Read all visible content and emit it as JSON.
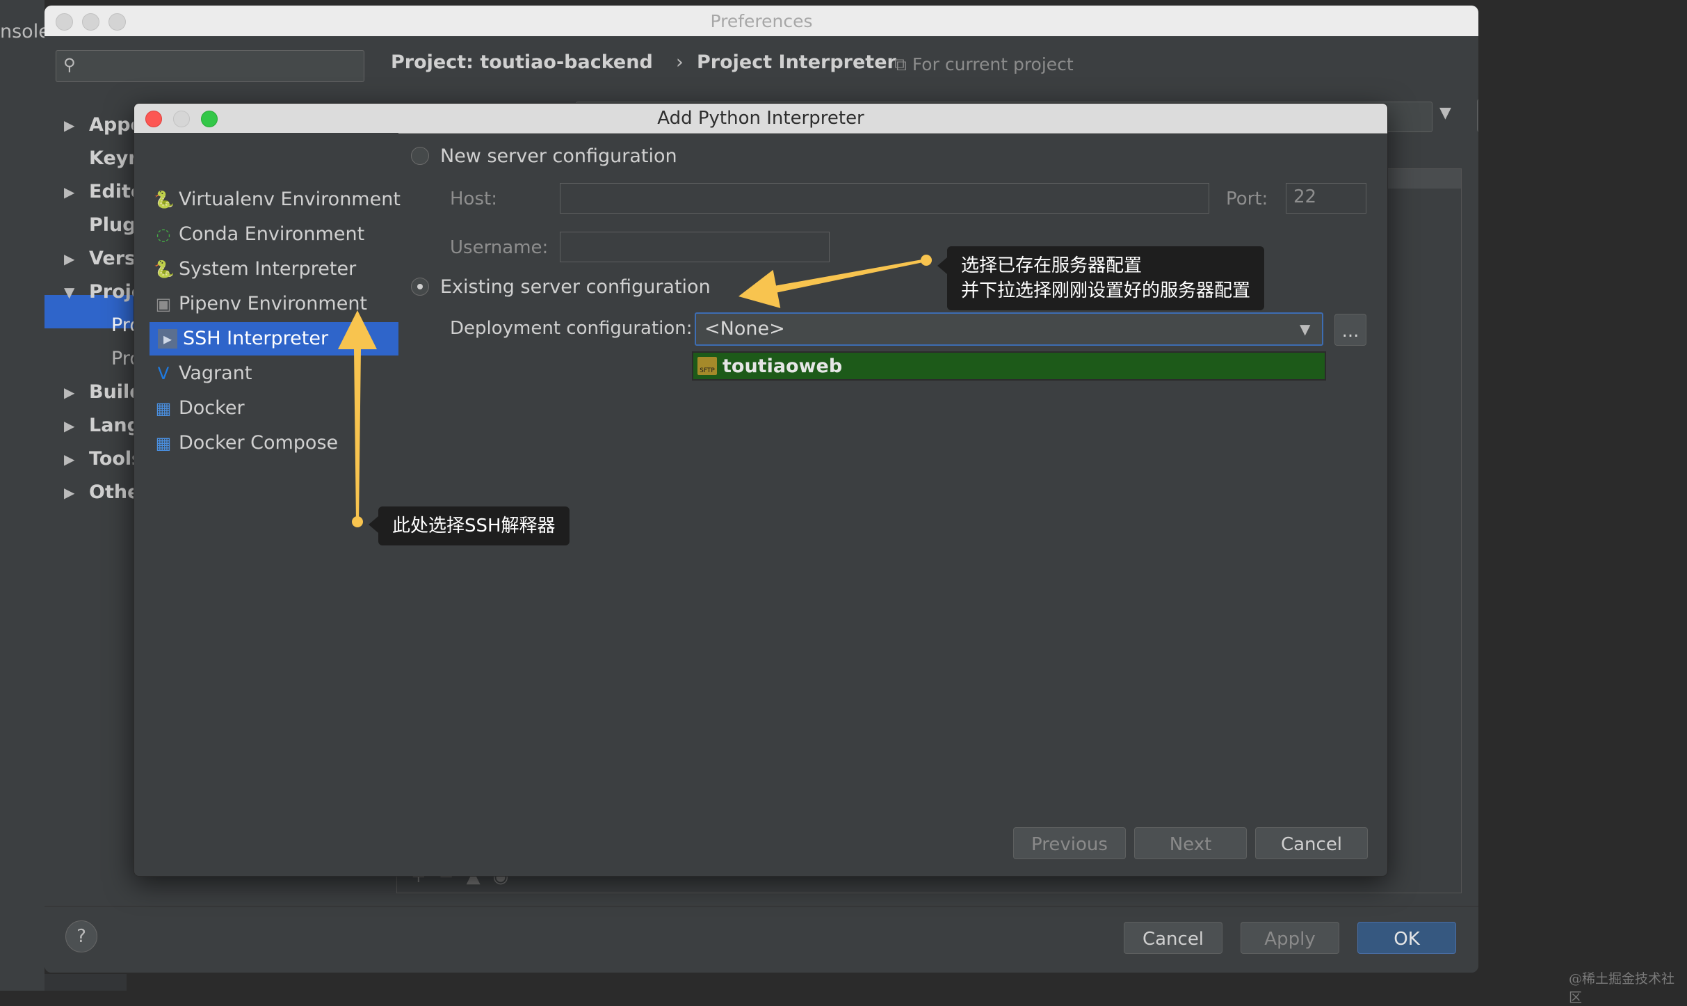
{
  "background": {
    "console_label": "nsole"
  },
  "preferences": {
    "title": "Preferences",
    "search_placeholder": "",
    "tree": [
      {
        "label": "Appe",
        "arrow": "▶",
        "bold": true
      },
      {
        "label": "Keyn",
        "arrow": "",
        "bold": true
      },
      {
        "label": "Edito",
        "arrow": "▶",
        "bold": true
      },
      {
        "label": "Plugi",
        "arrow": "",
        "bold": true
      },
      {
        "label": "Versi",
        "arrow": "▶",
        "bold": true
      },
      {
        "label": "Proje",
        "arrow": "▼",
        "bold": true
      },
      {
        "label": "Pro",
        "arrow": "",
        "bold": false,
        "selected": true
      },
      {
        "label": "Pro",
        "arrow": "",
        "bold": false
      },
      {
        "label": "Build",
        "arrow": "▶",
        "bold": true
      },
      {
        "label": "Lang",
        "arrow": "▶",
        "bold": true
      },
      {
        "label": "Tools",
        "arrow": "▶",
        "bold": true
      },
      {
        "label": "Othe",
        "arrow": "▶",
        "bold": true
      }
    ],
    "breadcrumb": {
      "project": "Project: toutiao-backend",
      "separator": "›",
      "page": "Project Interpreter"
    },
    "for_current_project": "For current project",
    "footer": {
      "help": "?",
      "cancel": "Cancel",
      "apply": "Apply",
      "ok": "OK"
    }
  },
  "dialog": {
    "title": "Add Python Interpreter",
    "environments": [
      {
        "label": "Virtualenv Environment",
        "icon": "python-icon",
        "glyph": "🐍",
        "color": "#f0c040"
      },
      {
        "label": "Conda Environment",
        "icon": "conda-icon",
        "glyph": "◌",
        "color": "#44aa44"
      },
      {
        "label": "System Interpreter",
        "icon": "python-icon",
        "glyph": "🐍",
        "color": "#4f8ac9"
      },
      {
        "label": "Pipenv Environment",
        "icon": "pipenv-icon",
        "glyph": "▣",
        "color": "#8c8c8c"
      },
      {
        "label": "SSH Interpreter",
        "icon": "terminal-icon",
        "glyph": "▸",
        "color": "#cfd8e6",
        "selected": true
      },
      {
        "label": "Vagrant",
        "icon": "vagrant-icon",
        "glyph": "V",
        "color": "#1f7ae0"
      },
      {
        "label": "Docker",
        "icon": "docker-icon",
        "glyph": "▦",
        "color": "#4a90e2"
      },
      {
        "label": "Docker Compose",
        "icon": "docker-compose-icon",
        "glyph": "▦",
        "color": "#4a90e2"
      }
    ],
    "new_server": {
      "label": "New server configuration",
      "host_label": "Host:",
      "host_value": "",
      "port_label": "Port:",
      "port_value": "22",
      "username_label": "Username:",
      "username_value": ""
    },
    "existing_server": {
      "label": "Existing server configuration",
      "deployment_label": "Deployment configuration:",
      "deployment_value": "<None>",
      "dots": "...",
      "dropdown_option": "toutiaoweb",
      "dropdown_icon_text": "SFTP"
    },
    "buttons": {
      "previous": "Previous",
      "next": "Next",
      "cancel": "Cancel"
    }
  },
  "annotations": {
    "callout_existing_line1": "选择已存在服务器配置",
    "callout_existing_line2": "并下拉选择刚刚设置好的服务器配置",
    "callout_ssh": "此处选择SSH解释器",
    "arrow_color": "#f8c44f"
  },
  "watermark": "@稀土掘金技术社区"
}
